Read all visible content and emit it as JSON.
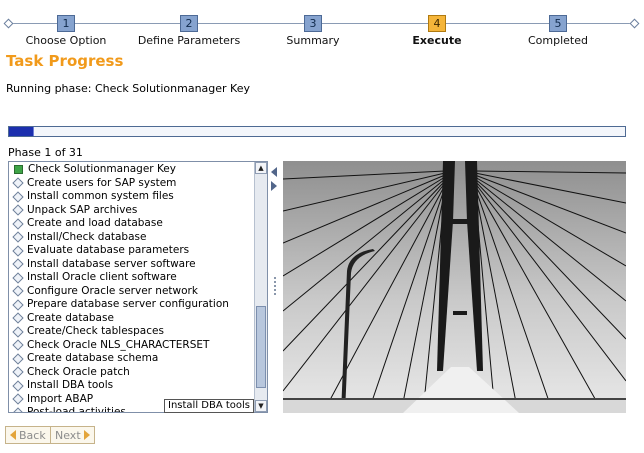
{
  "wizard": {
    "steps": [
      {
        "number": "1",
        "label": "Choose Option"
      },
      {
        "number": "2",
        "label": "Define Parameters"
      },
      {
        "number": "3",
        "label": "Summary"
      },
      {
        "number": "4",
        "label": "Execute"
      },
      {
        "number": "5",
        "label": "Completed"
      }
    ],
    "active_step": "4"
  },
  "task": {
    "title": "Task Progress",
    "running_phase": "Running phase: Check Solutionmanager Key",
    "progress_fraction": 0.04,
    "phase_count": "Phase 1 of 31"
  },
  "phases": [
    "Check Solutionmanager Key",
    "Create users for SAP system",
    "Install common system files",
    "Unpack SAP archives",
    "Create and load database",
    "Install/Check database",
    "Evaluate database parameters",
    "Install database server software",
    "Install Oracle client software",
    "Configure Oracle server network",
    "Prepare database server configuration",
    "Create database",
    "Create/Check tablespaces",
    "Check Oracle NLS_CHARACTERSET",
    "Create database schema",
    "Check Oracle patch",
    "Install DBA tools",
    "Import ABAP",
    "Post-load activities"
  ],
  "tooltip": "Install DBA tools",
  "buttons": {
    "back": "Back",
    "next": "Next"
  },
  "colors": {
    "title_orange": "#f19a1b",
    "progress_blue": "#1c2fae",
    "step_active": "#f5b53a",
    "step_inactive": "#86a3cf",
    "done_green": "#3ea447"
  }
}
